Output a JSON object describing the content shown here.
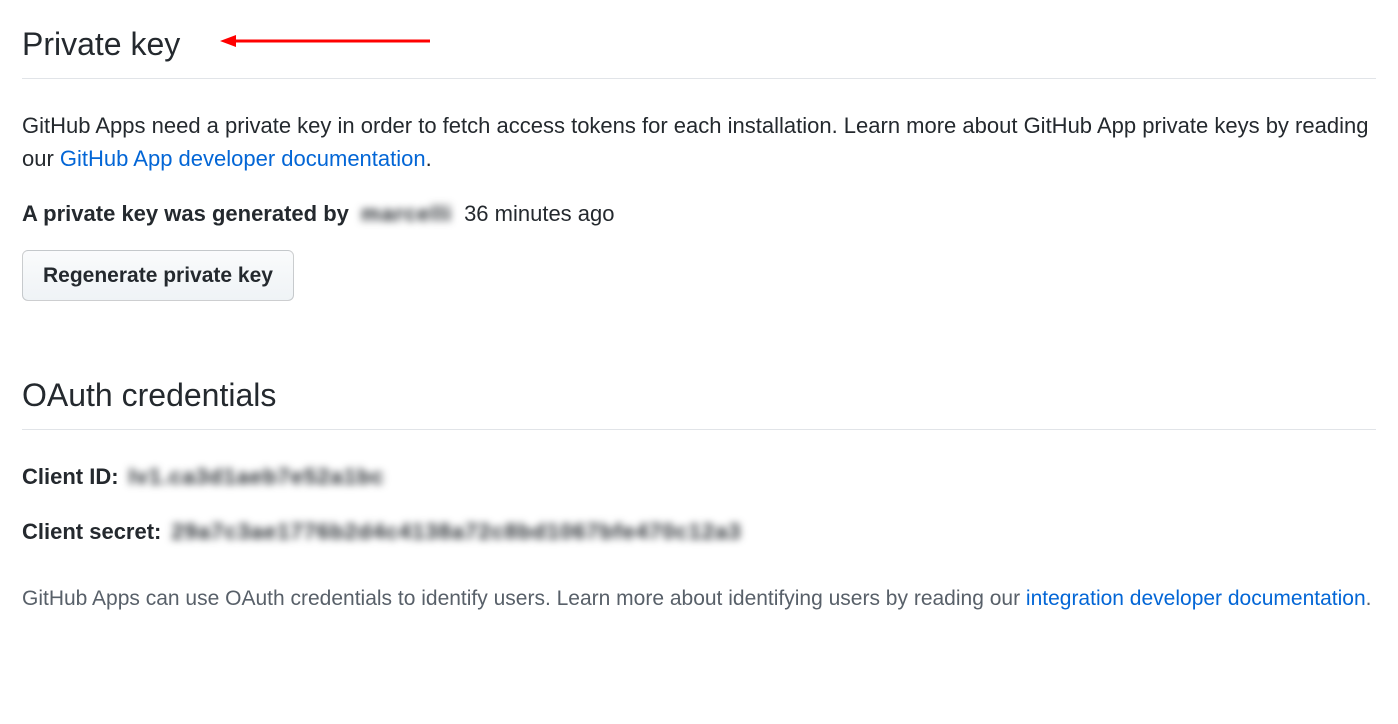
{
  "private_key": {
    "heading": "Private key",
    "description_before_link": "GitHub Apps need a private key in order to fetch access tokens for each installation. Learn more about GitHub App private keys by reading our ",
    "description_link": "GitHub App developer documentation",
    "description_after_link": ".",
    "generated_prefix": "A private key was generated by",
    "generated_user_blurred": "marcelli",
    "generated_time": "36 minutes ago",
    "regenerate_button": "Regenerate private key"
  },
  "oauth": {
    "heading": "OAuth credentials",
    "client_id_label": "Client ID:",
    "client_id_value_blurred": "Iv1.ca3d1aeb7e52a1bc",
    "client_secret_label": "Client secret:",
    "client_secret_value_blurred": "29a7c3ae1776b2d4c4138a72c8bd1067bfe470c12a3",
    "description_before_link": "GitHub Apps can use OAuth credentials to identify users. Learn more about identifying users by reading our ",
    "description_link": "integration developer documentation",
    "description_after_link": "."
  },
  "colors": {
    "link": "#0366d6",
    "arrow": "#ff0000"
  }
}
